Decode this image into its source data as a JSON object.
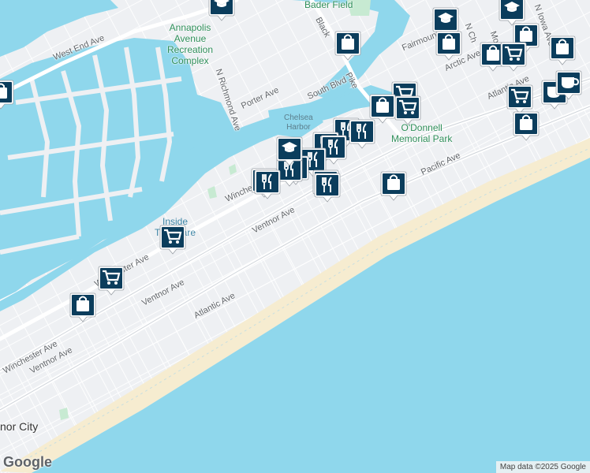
{
  "map": {
    "labels": {
      "west_end_ave": "West End Ave",
      "annapolis": "Annapolis\nAvenue\nRecreation\nComplex",
      "bader_field": "Bader Field",
      "black_horse": "Black",
      "pike": "Pike",
      "n_richmond": "N Richmond Ave",
      "porter": "Porter Ave",
      "south_blvd": "South Blvd",
      "fairmount": "Fairmount",
      "arctic": "Arctic Ave",
      "chelsea_harbor": "Chelsea\nHarbor",
      "odonnell": "O'Donnell\nMemorial Park",
      "pacific": "Pacific Ave",
      "atlantic_top": "Atlantic Ave",
      "winchester_top": "Winches",
      "ventnor_top": "Ventnor Ave",
      "inside": "Inside\nThorofare",
      "winchester_mid": "Winchester Ave",
      "ventnor_mid": "Ventnor Ave",
      "atlantic_mid": "Atlantic Ave",
      "winchester_low": "Winchester Ave",
      "ventnor_low": "Ventnor Ave",
      "ventnor_city": "nor City",
      "n_ch": "N Ch",
      "n_iowa": "N Iowa Ave",
      "mo": "Mo"
    },
    "markers": [
      {
        "type": "education",
        "icon": "graduation-cap-icon"
      },
      {
        "type": "education",
        "icon": "graduation-cap-icon"
      },
      {
        "type": "education",
        "icon": "graduation-cap-icon"
      },
      {
        "type": "shopping",
        "icon": "shopping-bag-icon"
      },
      {
        "type": "shopping",
        "icon": "shopping-bag-icon"
      },
      {
        "type": "shopping",
        "icon": "shopping-bag-icon"
      },
      {
        "type": "shopping",
        "icon": "shopping-bag-icon"
      },
      {
        "type": "shopping",
        "icon": "shopping-bag-icon"
      },
      {
        "type": "grocery",
        "icon": "shopping-cart-icon"
      },
      {
        "type": "grocery",
        "icon": "shopping-cart-icon"
      },
      {
        "type": "grocery",
        "icon": "shopping-cart-icon"
      },
      {
        "type": "cafe",
        "icon": "coffee-cup-icon"
      },
      {
        "type": "cafe",
        "icon": "coffee-cup-icon"
      },
      {
        "type": "shopping",
        "icon": "shopping-bag-icon"
      },
      {
        "type": "grocery",
        "icon": "shopping-cart-icon"
      },
      {
        "type": "shopping",
        "icon": "shopping-bag-icon"
      },
      {
        "type": "restaurant",
        "icon": "fork-knife-icon"
      },
      {
        "type": "restaurant",
        "icon": "fork-knife-icon"
      },
      {
        "type": "restaurant",
        "icon": "fork-knife-icon"
      },
      {
        "type": "restaurant",
        "icon": "fork-knife-icon"
      },
      {
        "type": "restaurant",
        "icon": "fork-knife-icon"
      },
      {
        "type": "restaurant",
        "icon": "fork-knife-icon"
      },
      {
        "type": "restaurant",
        "icon": "fork-knife-icon"
      },
      {
        "type": "restaurant",
        "icon": "fork-knife-icon"
      },
      {
        "type": "education",
        "icon": "graduation-cap-icon"
      },
      {
        "type": "restaurant",
        "icon": "fork-knife-icon"
      },
      {
        "type": "restaurant",
        "icon": "fork-knife-icon"
      },
      {
        "type": "restaurant",
        "icon": "fork-knife-icon"
      },
      {
        "type": "shopping",
        "icon": "shopping-bag-icon"
      },
      {
        "type": "grocery",
        "icon": "shopping-cart-icon"
      },
      {
        "type": "grocery",
        "icon": "shopping-cart-icon"
      },
      {
        "type": "shopping",
        "icon": "shopping-bag-icon"
      },
      {
        "type": "shopping",
        "icon": "shopping-bag-icon"
      }
    ],
    "colors": {
      "land": "#eef0f3",
      "water": "#8fd7ec",
      "marker": "#0b3d5c",
      "park": "#c7ead2"
    }
  },
  "footer": {
    "logo": "Google",
    "attribution": "Map data ©2025 Google"
  }
}
